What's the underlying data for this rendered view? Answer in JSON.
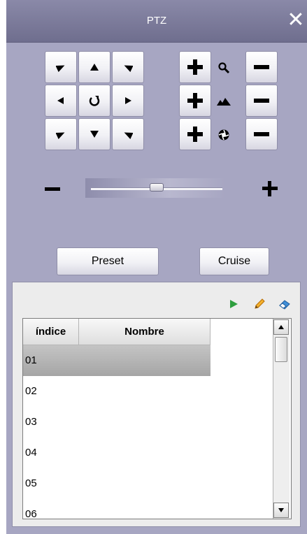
{
  "window": {
    "title": "PTZ",
    "close_icon": "close-icon"
  },
  "direction_pad": {
    "icons": [
      "arrow-up-left-icon",
      "arrow-up-icon",
      "arrow-up-right-icon",
      "arrow-left-icon",
      "rotate-icon",
      "arrow-right-icon",
      "arrow-down-left-icon",
      "arrow-down-icon",
      "arrow-down-right-icon"
    ]
  },
  "adjust_rows": [
    {
      "name": "zoom",
      "icon": "zoom-icon"
    },
    {
      "name": "focus",
      "icon": "focus-icon"
    },
    {
      "name": "iris",
      "icon": "iris-icon"
    }
  ],
  "speed_slider": {
    "level": 0.5
  },
  "buttons": {
    "preset": "Preset",
    "cruise": "Cruise"
  },
  "toolbar": {
    "icons": [
      "play-icon",
      "edit-icon",
      "erase-icon"
    ]
  },
  "table": {
    "columns": [
      "índice",
      "Nombre"
    ],
    "rows": [
      "01",
      "02",
      "03",
      "04",
      "05",
      "06"
    ],
    "selected_row": 0
  },
  "colors": {
    "panel": "#a7a6c2",
    "titlebar": "#7b7a99",
    "selected_row": "#b4b4b4",
    "play": "#2e9e3e"
  }
}
